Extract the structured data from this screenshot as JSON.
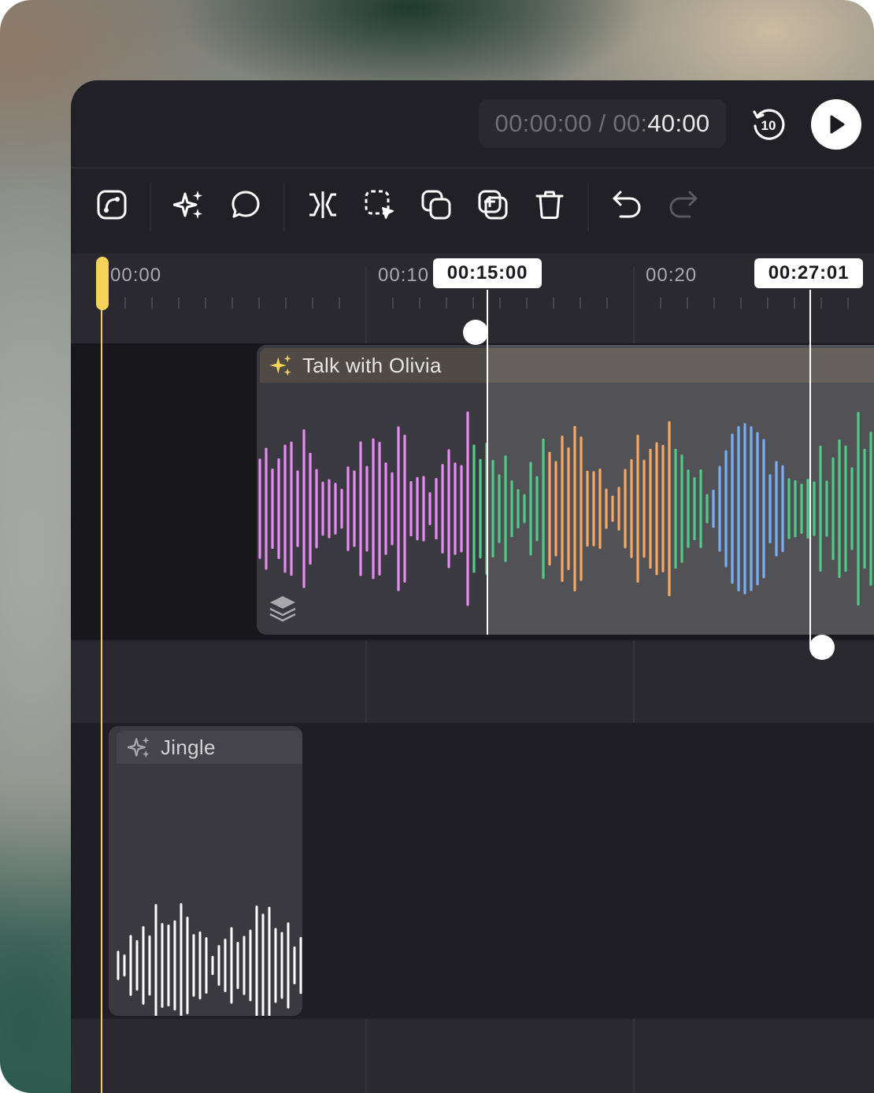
{
  "time_display": {
    "current_dim": "00:00:00 / 00:",
    "current_bright": "40:00"
  },
  "ruler": {
    "labels": [
      "00:00",
      "00:10",
      "00:20"
    ]
  },
  "markers": {
    "start": "00:15:00",
    "end": "00:27:01"
  },
  "clips": {
    "talk": {
      "title": "Talk with Olivia"
    },
    "jingle": {
      "title": "Jingle"
    }
  },
  "icons": {
    "replay": "replay-10-icon",
    "play": "play-icon",
    "toolbar": [
      "path-icon",
      "sparkles-icon",
      "comment-icon",
      "split-icon",
      "select-icon",
      "duplicate-icon",
      "add-icon",
      "trash-icon",
      "undo-icon",
      "redo-icon"
    ],
    "layers": "layers-icon"
  },
  "colors": {
    "accent": "#f5d35a",
    "wave_pink": "#e28ef0",
    "wave_green": "#55c98a",
    "wave_orange": "#f3a967",
    "wave_blue": "#7aaef2",
    "wave_white": "#ffffff"
  }
}
